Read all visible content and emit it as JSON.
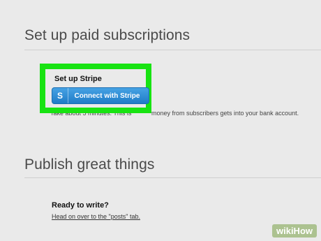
{
  "subscriptions": {
    "title": "Set up paid subscriptions"
  },
  "stripe": {
    "heading": "Set up Stripe",
    "button_icon": "S",
    "button_label": "Connect with Stripe",
    "explanation_left": "Take about 5 minutes. This is",
    "explanation_right": "money from subscribers gets into your bank account.",
    "highlight_color": "#18e312",
    "button_color": "#2a8ad6"
  },
  "publish": {
    "title": "Publish great things",
    "ready_title": "Ready to write?",
    "link_text": "Head on over to the \"posts\" tab."
  },
  "watermark": {
    "text": "wikiHow"
  }
}
